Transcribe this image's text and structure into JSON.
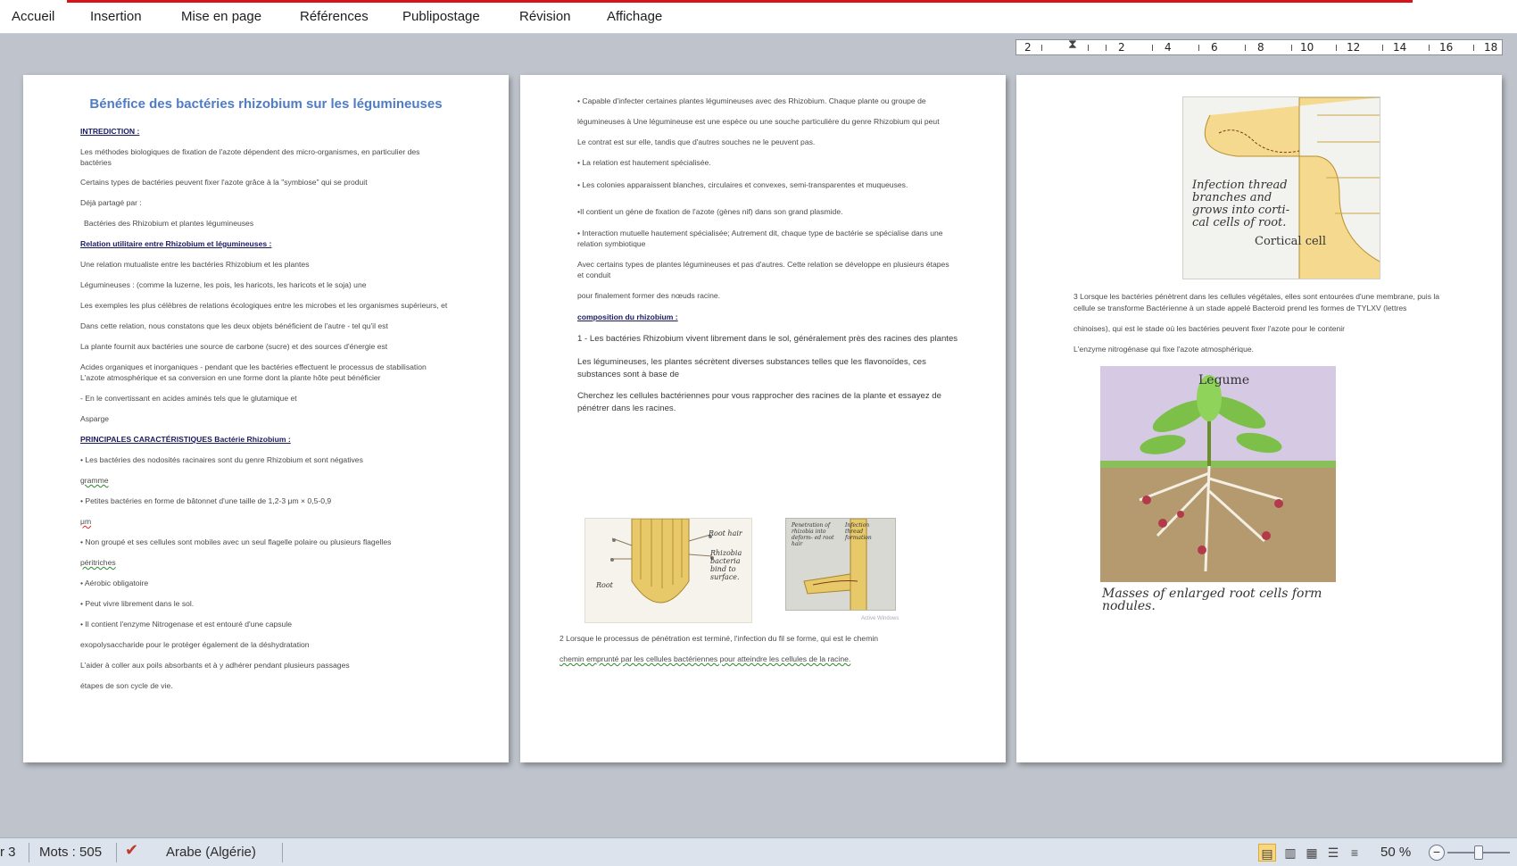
{
  "ribbon": {
    "tabs": [
      "Accueil",
      "Insertion",
      "Mise en page",
      "Références",
      "Publipostage",
      "Révision",
      "Affichage"
    ]
  },
  "ruler": {
    "numbers": [
      "2",
      "2",
      "4",
      "6",
      "8",
      "10",
      "12",
      "14",
      "16",
      "18"
    ]
  },
  "page1": {
    "title": "Bénéfice des bactéries rhizobium sur les légumineuses",
    "lines": [
      "INTREDICTION :",
      "Les méthodes biologiques de fixation de l'azote dépendent des micro-organismes, en particulier des",
      "bactéries",
      "Certains types de bactéries peuvent fixer l'azote grâce à la \"symbiose\" qui se produit",
      "Déjà partagé par :",
      "Bactéries des Rhizobium et plantes légumineuses",
      "Relation utilitaire entre Rhizobium et légumineuses :",
      "Une relation mutualiste entre les bactéries Rhizobium et les plantes",
      "Légumineuses : (comme la luzerne, les pois, les haricots, les haricots et le soja) une",
      "Les exemples les plus célèbres de relations écologiques entre les microbes et les organismes supérieurs, et",
      "Dans cette relation, nous constatons que les deux objets bénéficient de l'autre - tel qu'il est",
      "La plante fournit aux bactéries une source de carbone (sucre) et des sources d'énergie est",
      "Acides organiques et inorganiques - pendant que les bactéries effectuent le processus de stabilisation",
      "L'azote atmosphérique et sa conversion en une forme dont la plante hôte peut bénéficier",
      "- En le convertissant en acides aminés tels que le glutamique et",
      "Asparge",
      "PRINCIPALES CARACTÉRISTIQUES Bactérie Rhizobium :",
      "• Les bactéries des nodosités racinaires sont du genre Rhizobium et sont négatives",
      "gramme",
      "• Petites bactéries en forme de bâtonnet d'une taille de 1,2-3 μm × 0,5-0,9",
      "μm",
      "• Non groupé et ses cellules sont mobiles avec un seul flagelle polaire ou plusieurs flagelles",
      "péritriches",
      "• Aérobic obligatoire",
      "• Peut vivre librement dans le sol.",
      "• Il contient l'enzyme Nitrogenase et est entouré d'une capsule",
      "exopolysaccharide pour le protéger également de la déshydratation",
      "L'aider à coller aux poils absorbants et à y adhérer pendant plusieurs passages",
      "étapes de son cycle de vie."
    ]
  },
  "page2": {
    "lines": [
      "• Capable d'infecter certaines plantes légumineuses avec des Rhizobium. Chaque plante ou groupe de",
      "légumineuses à Une légumineuse est une espèce ou une souche particulière du genre Rhizobium qui peut",
      "Le contrat est sur elle, tandis que d'autres souches ne le peuvent pas.",
      "• La relation est hautement spécialisée.",
      "• Les colonies apparaissent blanches, circulaires et convexes, semi-transparentes et muqueuses.",
      "•Il contient un gène de fixation de l'azote (gènes nif) dans son grand plasmide.",
      "• Interaction mutuelle hautement spécialisée; Autrement dit, chaque type de bactérie se spécialise dans une",
      "relation symbiotique",
      "Avec certains types de plantes légumineuses et pas d'autres. Cette relation se développe en plusieurs étapes",
      "et conduit",
      "pour finalement former des nœuds racine.",
      "composition du rhizobium :",
      "1 - Les bactéries Rhizobium vivent librement dans le sol, généralement près des racines des plantes",
      "Les légumineuses, les plantes sécrètent diverses substances telles que les flavonoïdes, ces",
      "substances sont à base de",
      "Cherchez les cellules bactériennes pour vous rapprocher des racines de la plante et essayez de",
      "pénétrer dans les racines.",
      "2 Lorsque le processus de pénétration est terminé, l'infection du fil se forme, qui est le chemin",
      "chemin emprunté par les cellules bactériennes pour atteindre les cellules de la racine."
    ],
    "fig1_labels": [
      "Root hair",
      "Rhizobia bacteria bind to surface.",
      "Root"
    ],
    "fig2_labels": [
      "Penetration of rhizobia into deform- ed root hair",
      "Infection thread formation"
    ],
    "watermark": "Active Windows"
  },
  "page3": {
    "fig_top_labels": [
      "Infection thread branches and grows into corti- cal cells of root.",
      "Cortical cell"
    ],
    "lines": [
      "3 Lorsque les bactéries pénètrent dans les cellules végétales, elles sont entourées d'une membrane, puis la",
      "cellule se transforme Bactérienne à un stade appelé Bacteroid prend les formes de TYLXV (lettres",
      "chinoises), qui est le stade où les bactéries peuvent fixer l'azote pour le contenir",
      "L'enzyme nitrogénase qui fixe l'azote atmosphérique."
    ],
    "fig_bottom_title": "Legume",
    "fig_bottom_caption": "Masses of enlarged root cells form nodules."
  },
  "statusbar": {
    "page_fragment": "r 3",
    "words": "Mots : 505",
    "language": "Arabe (Algérie)",
    "zoom": "50 %"
  }
}
